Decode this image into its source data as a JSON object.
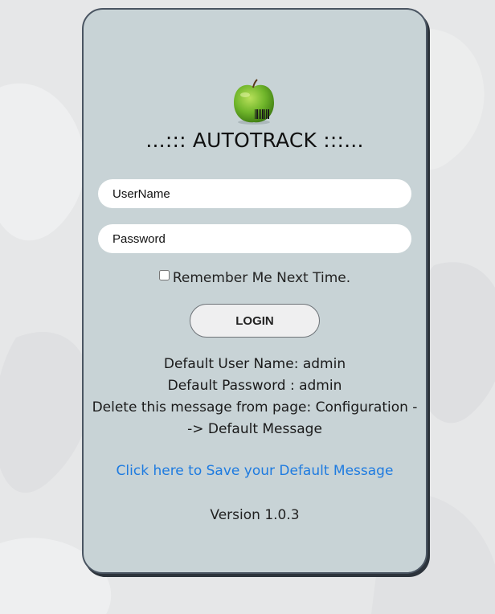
{
  "app": {
    "title": "...::: AUTOTRACK :::..."
  },
  "login_form": {
    "username_placeholder": "UserName",
    "password_placeholder": "Password",
    "remember_label": "Remember Me Next Time.",
    "remember_checked": false,
    "login_button": "LOGIN"
  },
  "info": {
    "default_user": "Default User Name: admin",
    "default_password": "Default Password : admin",
    "delete_message": "Delete this message from page: Configuration --> Default Message"
  },
  "save_link": "Click here to Save your Default Message",
  "version": "Version 1.0.3",
  "colors": {
    "page_background": "#e6e7e8",
    "card_background": "#c8d3d6",
    "card_border": "#4a5562",
    "link": "#1e7be0"
  },
  "icons": {
    "logo": "green-apple-barcode-icon"
  }
}
